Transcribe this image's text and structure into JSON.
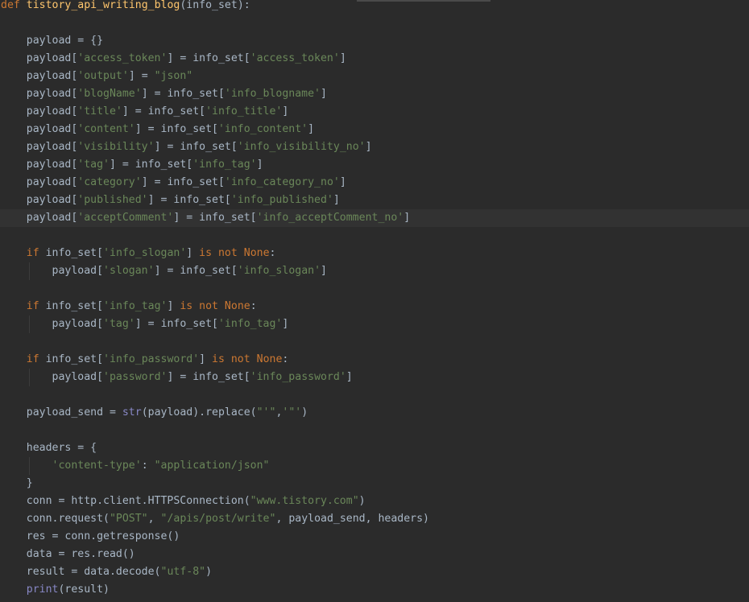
{
  "editor": {
    "lines": [
      [
        {
          "t": "def",
          "c": "kw"
        },
        {
          "t": " ",
          "c": "plain"
        },
        {
          "t": "tistory_api_writing_blog",
          "c": "fn"
        },
        {
          "t": "(",
          "c": "plain"
        },
        {
          "t": "info_set",
          "c": "plain"
        },
        {
          "t": "):",
          "c": "plain"
        }
      ],
      [],
      [
        {
          "t": "    payload = {}",
          "c": "plain"
        }
      ],
      [
        {
          "t": "    payload[",
          "c": "plain"
        },
        {
          "t": "'access_token'",
          "c": "str"
        },
        {
          "t": "] = info_set[",
          "c": "plain"
        },
        {
          "t": "'access_token'",
          "c": "str"
        },
        {
          "t": "]",
          "c": "plain"
        }
      ],
      [
        {
          "t": "    payload[",
          "c": "plain"
        },
        {
          "t": "'output'",
          "c": "str"
        },
        {
          "t": "] = ",
          "c": "plain"
        },
        {
          "t": "\"json\"",
          "c": "str"
        }
      ],
      [
        {
          "t": "    payload[",
          "c": "plain"
        },
        {
          "t": "'blogName'",
          "c": "str"
        },
        {
          "t": "] = info_set[",
          "c": "plain"
        },
        {
          "t": "'info_blogname'",
          "c": "str"
        },
        {
          "t": "]",
          "c": "plain"
        }
      ],
      [
        {
          "t": "    payload[",
          "c": "plain"
        },
        {
          "t": "'title'",
          "c": "str"
        },
        {
          "t": "] = info_set[",
          "c": "plain"
        },
        {
          "t": "'info_title'",
          "c": "str"
        },
        {
          "t": "]",
          "c": "plain"
        }
      ],
      [
        {
          "t": "    payload[",
          "c": "plain"
        },
        {
          "t": "'content'",
          "c": "str"
        },
        {
          "t": "] = info_set[",
          "c": "plain"
        },
        {
          "t": "'info_content'",
          "c": "str"
        },
        {
          "t": "]",
          "c": "plain"
        }
      ],
      [
        {
          "t": "    payload[",
          "c": "plain"
        },
        {
          "t": "'visibility'",
          "c": "str"
        },
        {
          "t": "] = info_set[",
          "c": "plain"
        },
        {
          "t": "'info_visibility_no'",
          "c": "str"
        },
        {
          "t": "]",
          "c": "plain"
        }
      ],
      [
        {
          "t": "    payload[",
          "c": "plain"
        },
        {
          "t": "'tag'",
          "c": "str"
        },
        {
          "t": "] = info_set[",
          "c": "plain"
        },
        {
          "t": "'info_tag'",
          "c": "str"
        },
        {
          "t": "]",
          "c": "plain"
        }
      ],
      [
        {
          "t": "    payload[",
          "c": "plain"
        },
        {
          "t": "'category'",
          "c": "str"
        },
        {
          "t": "] = info_set[",
          "c": "plain"
        },
        {
          "t": "'info_category_no'",
          "c": "str"
        },
        {
          "t": "]",
          "c": "plain"
        }
      ],
      [
        {
          "t": "    payload[",
          "c": "plain"
        },
        {
          "t": "'published'",
          "c": "str"
        },
        {
          "t": "] = info_set[",
          "c": "plain"
        },
        {
          "t": "'info_published'",
          "c": "str"
        },
        {
          "t": "]",
          "c": "plain"
        }
      ],
      [
        {
          "t": "    payload[",
          "c": "plain"
        },
        {
          "t": "'acceptComment'",
          "c": "str"
        },
        {
          "t": "] = info_set[",
          "c": "plain"
        },
        {
          "t": "'info_acceptComment_no'",
          "c": "str"
        },
        {
          "t": "]",
          "c": "plain"
        }
      ],
      [],
      [
        {
          "t": "    ",
          "c": "plain"
        },
        {
          "t": "if",
          "c": "kw"
        },
        {
          "t": " info_set[",
          "c": "plain"
        },
        {
          "t": "'info_slogan'",
          "c": "str"
        },
        {
          "t": "] ",
          "c": "plain"
        },
        {
          "t": "is not None",
          "c": "kw"
        },
        {
          "t": ":",
          "c": "plain"
        }
      ],
      [
        {
          "t": "        payload[",
          "c": "plain"
        },
        {
          "t": "'slogan'",
          "c": "str"
        },
        {
          "t": "] = info_set[",
          "c": "plain"
        },
        {
          "t": "'info_slogan'",
          "c": "str"
        },
        {
          "t": "]",
          "c": "plain"
        }
      ],
      [],
      [
        {
          "t": "    ",
          "c": "plain"
        },
        {
          "t": "if",
          "c": "kw"
        },
        {
          "t": " info_set[",
          "c": "plain"
        },
        {
          "t": "'info_tag'",
          "c": "str"
        },
        {
          "t": "] ",
          "c": "plain"
        },
        {
          "t": "is not None",
          "c": "kw"
        },
        {
          "t": ":",
          "c": "plain"
        }
      ],
      [
        {
          "t": "        payload[",
          "c": "plain"
        },
        {
          "t": "'tag'",
          "c": "str"
        },
        {
          "t": "] = info_set[",
          "c": "plain"
        },
        {
          "t": "'info_tag'",
          "c": "str"
        },
        {
          "t": "]",
          "c": "plain"
        }
      ],
      [],
      [
        {
          "t": "    ",
          "c": "plain"
        },
        {
          "t": "if",
          "c": "kw"
        },
        {
          "t": " info_set[",
          "c": "plain"
        },
        {
          "t": "'info_password'",
          "c": "str"
        },
        {
          "t": "] ",
          "c": "plain"
        },
        {
          "t": "is not None",
          "c": "kw"
        },
        {
          "t": ":",
          "c": "plain"
        }
      ],
      [
        {
          "t": "        payload[",
          "c": "plain"
        },
        {
          "t": "'password'",
          "c": "str"
        },
        {
          "t": "] = info_set[",
          "c": "plain"
        },
        {
          "t": "'info_password'",
          "c": "str"
        },
        {
          "t": "]",
          "c": "plain"
        }
      ],
      [],
      [
        {
          "t": "    payload_send = ",
          "c": "plain"
        },
        {
          "t": "str",
          "c": "builtin"
        },
        {
          "t": "(payload).replace(",
          "c": "plain"
        },
        {
          "t": "\"'\"",
          "c": "str"
        },
        {
          "t": ",",
          "c": "plain"
        },
        {
          "t": "'\"'",
          "c": "str"
        },
        {
          "t": ")",
          "c": "plain"
        }
      ],
      [],
      [
        {
          "t": "    headers = {",
          "c": "plain"
        }
      ],
      [
        {
          "t": "        ",
          "c": "plain"
        },
        {
          "t": "'content-type'",
          "c": "str"
        },
        {
          "t": ": ",
          "c": "plain"
        },
        {
          "t": "\"application/json\"",
          "c": "str"
        }
      ],
      [
        {
          "t": "    }",
          "c": "plain"
        }
      ],
      [
        {
          "t": "    conn = http.client.HTTPSConnection(",
          "c": "plain"
        },
        {
          "t": "\"www.tistory.com\"",
          "c": "str"
        },
        {
          "t": ")",
          "c": "plain"
        }
      ],
      [
        {
          "t": "    conn.request(",
          "c": "plain"
        },
        {
          "t": "\"POST\"",
          "c": "str"
        },
        {
          "t": ", ",
          "c": "plain"
        },
        {
          "t": "\"/apis/post/write\"",
          "c": "str"
        },
        {
          "t": ", payload_send, headers)",
          "c": "plain"
        }
      ],
      [
        {
          "t": "    res = conn.getresponse()",
          "c": "plain"
        }
      ],
      [
        {
          "t": "    data = res.read()",
          "c": "plain"
        }
      ],
      [
        {
          "t": "    result = data.decode(",
          "c": "plain"
        },
        {
          "t": "\"utf-8\"",
          "c": "str"
        },
        {
          "t": ")",
          "c": "plain"
        }
      ],
      [
        {
          "t": "    ",
          "c": "plain"
        },
        {
          "t": "print",
          "c": "builtin"
        },
        {
          "t": "(result)",
          "c": "plain"
        }
      ]
    ],
    "current_line_index": 12
  },
  "colors": {
    "background": "#2b2b2b",
    "keyword": "#cc7832",
    "function": "#ffc66d",
    "string": "#6a8759",
    "plain": "#a9b7c6",
    "builtin": "#8888c6",
    "current_line": "#323232"
  }
}
